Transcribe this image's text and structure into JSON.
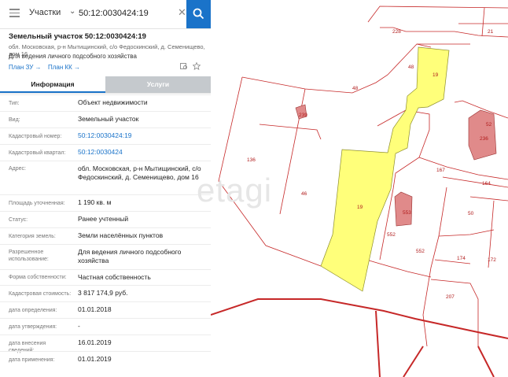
{
  "search": {
    "layer": "Участки",
    "value": "50:12:0030424:19"
  },
  "parcel": {
    "title": "Земельный участок 50:12:0030424:19",
    "address": "обл. Московская, р-н Мытищинский, с/о Федоскинский, д. Семенищево, дом 16",
    "purpose": "Для ведения личного подсобного хозяйства"
  },
  "links": {
    "plan_zu": "План ЗУ →",
    "plan_kk": "План КК →"
  },
  "tabs": {
    "info": "Информация",
    "services": "Услуги"
  },
  "rows": [
    {
      "label": "Тип:",
      "value": "Объект недвижимости"
    },
    {
      "label": "Вид:",
      "value": "Земельный участок"
    },
    {
      "label": "Кадастровый номер:",
      "value": "50:12:0030424:19"
    },
    {
      "label": "Кадастровый квартал:",
      "value": "50:12:0030424"
    },
    {
      "label": "Адрес:",
      "value": "обл. Московская, р-н Мытищинский, с/о Федоскинский, д. Семенищево, дом 16"
    },
    {
      "label": "Площадь уточненная:",
      "value": "1 190 кв. м"
    },
    {
      "label": "Статус:",
      "value": "Ранее учтенный"
    },
    {
      "label": "Категория земель:",
      "value": "Земли населённых пунктов"
    },
    {
      "label": "Разрешенное использование:",
      "value": "Для ведения личного подсобного хозяйства"
    },
    {
      "label": "Форма собственности:",
      "value": "Частная собственность"
    },
    {
      "label": "Кадастровая стоимость:",
      "value": "3 817 174,9 руб."
    },
    {
      "label": "дата определения:",
      "value": "01.01.2018"
    },
    {
      "label": "дата утверждения:",
      "value": "-"
    },
    {
      "label": "дата внесения сведений:",
      "value": "16.01.2019"
    },
    {
      "label": "дата применения:",
      "value": "01.01.2019"
    }
  ],
  "map_labels": {
    "l228": "228",
    "l21": "21",
    "l48a": "48",
    "l19a": "19",
    "l48b": "48",
    "l52": "52",
    "l236": "236",
    "l239": "239",
    "l136": "136",
    "l167": "167",
    "l164": "164",
    "l46": "46",
    "l19b": "19",
    "l50": "50",
    "l553": "553",
    "l552a": "552",
    "l552b": "552",
    "l174": "174",
    "l207": "207",
    "l172": "172"
  },
  "watermark": "etagi",
  "colors": {
    "accent": "#1a73c9",
    "parcel_fill": "#ffff7a",
    "building": "#e08a8a",
    "boundary": "#c62828"
  }
}
